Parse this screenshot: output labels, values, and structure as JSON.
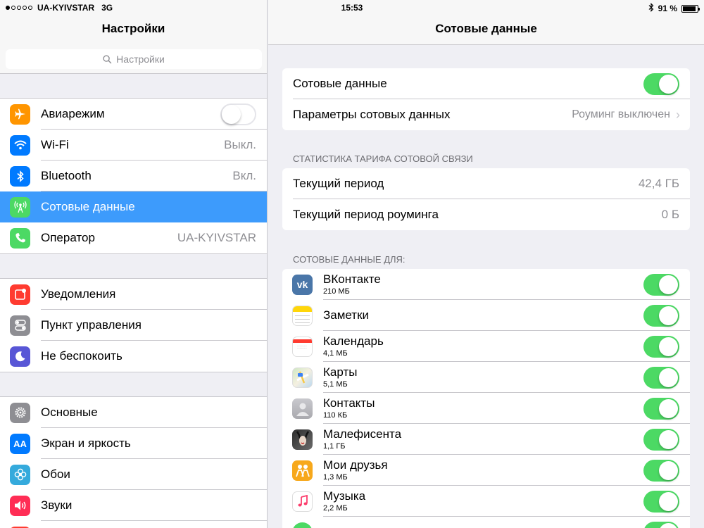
{
  "status_bar": {
    "carrier": "UA-KYIVSTAR",
    "network": "3G",
    "time": "15:53",
    "battery": "91 %",
    "battery_level": 0.91,
    "signal_bars": 1
  },
  "left": {
    "title": "Настройки",
    "search_placeholder": "Настройки",
    "groups": [
      [
        {
          "label": "Авиарежим",
          "icon": "airplane-icon",
          "color": "#ff9500",
          "toggle": "off"
        },
        {
          "label": "Wi-Fi",
          "icon": "wifi-icon",
          "color": "#007aff",
          "value": "Выкл."
        },
        {
          "label": "Bluetooth",
          "icon": "bluetooth-icon",
          "color": "#007aff",
          "value": "Вкл."
        },
        {
          "label": "Сотовые данные",
          "icon": "antenna-icon",
          "color": "#4cd964",
          "selected": true
        },
        {
          "label": "Оператор",
          "icon": "phone-icon",
          "color": "#4cd964",
          "value": "UA-KYIVSTAR"
        }
      ],
      [
        {
          "label": "Уведомления",
          "icon": "notifications-icon",
          "color": "#ff3b30"
        },
        {
          "label": "Пункт управления",
          "icon": "control-center-icon",
          "color": "#8e8e93"
        },
        {
          "label": "Не беспокоить",
          "icon": "moon-icon",
          "color": "#5856d6"
        }
      ],
      [
        {
          "label": "Основные",
          "icon": "gear-icon",
          "color": "#8e8e93"
        },
        {
          "label": "Экран и яркость",
          "icon": "text-size-icon",
          "color": "#007aff"
        },
        {
          "label": "Обои",
          "icon": "flower-icon",
          "color": "#35aadc"
        },
        {
          "label": "Звуки",
          "icon": "speaker-icon",
          "color": "#ff2d55"
        }
      ]
    ]
  },
  "right": {
    "title": "Сотовые данные",
    "cellular_row": {
      "label": "Сотовые данные",
      "toggle": "on"
    },
    "options_row": {
      "label": "Параметры сотовых данных",
      "value": "Роуминг выключен"
    },
    "stats_header": "СТАТИСТИКА ТАРИФА СОТОВОЙ СВЯЗИ",
    "stats": [
      {
        "label": "Текущий период",
        "value": "42,4 ГБ"
      },
      {
        "label": "Текущий период роуминга",
        "value": "0 Б"
      }
    ],
    "apps_header": "СОТОВЫЕ ДАННЫЕ ДЛЯ:",
    "apps": [
      {
        "name": "ВКонтакте",
        "size": "210 МБ",
        "icon": "vk-icon",
        "toggle": "on"
      },
      {
        "name": "Заметки",
        "size": "",
        "icon": "notes-icon",
        "toggle": "on"
      },
      {
        "name": "Календарь",
        "size": "4,1 МБ",
        "icon": "calendar-icon",
        "toggle": "on"
      },
      {
        "name": "Карты",
        "size": "5,1 МБ",
        "icon": "maps-icon",
        "toggle": "on"
      },
      {
        "name": "Контакты",
        "size": "110 КБ",
        "icon": "contacts-icon",
        "toggle": "on"
      },
      {
        "name": "Малефисента",
        "size": "1,1 ГБ",
        "icon": "maleficent-icon",
        "toggle": "on"
      },
      {
        "name": "Мои друзья",
        "size": "1,3 МБ",
        "icon": "find-friends-icon",
        "toggle": "on"
      },
      {
        "name": "Музыка",
        "size": "2,2 МБ",
        "icon": "music-icon",
        "toggle": "on"
      }
    ]
  },
  "colors": {
    "accent": "#3d9bfc",
    "switch_on": "#4cd964"
  }
}
